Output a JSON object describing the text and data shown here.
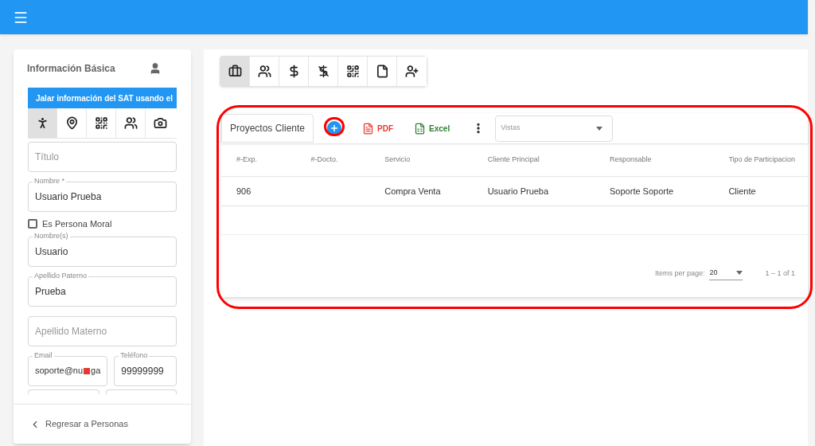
{
  "sidebar": {
    "title": "Información Básica",
    "sat_button": "Jalar información del SAT usando el",
    "tabs": [
      {
        "kind": "person",
        "selected": true
      },
      {
        "kind": "pin",
        "selected": false
      },
      {
        "kind": "qr",
        "selected": false
      },
      {
        "kind": "people",
        "selected": false
      },
      {
        "kind": "camera",
        "selected": false
      }
    ],
    "fields": [
      {
        "kind": "input",
        "placeholder": "Título"
      },
      {
        "kind": "input",
        "label": "Nombre *",
        "value": "Usuario Prueba"
      },
      {
        "kind": "checkbox",
        "label": "Es Persona Moral",
        "checked": false
      },
      {
        "kind": "input",
        "label": "Nombre(s)",
        "value": "Usuario"
      },
      {
        "kind": "input",
        "label": "Apellido Paterno",
        "value": "Prueba"
      },
      {
        "kind": "input",
        "placeholder": "Apellido Materno"
      },
      {
        "kind": "pair",
        "items": [
          {
            "label": "Email",
            "value": "soporte@nu",
            "value_end": "ga",
            "redacted": true
          },
          {
            "label": "Teléfono",
            "value": "99999999"
          }
        ]
      }
    ],
    "back": "Regresar a Personas"
  },
  "toolbar": [
    {
      "kind": "briefcase",
      "selected": true
    },
    {
      "kind": "people",
      "selected": false
    },
    {
      "kind": "dollar",
      "selected": false
    },
    {
      "kind": "dollar-off",
      "selected": false
    },
    {
      "kind": "qr",
      "selected": false
    },
    {
      "kind": "file",
      "selected": false
    },
    {
      "kind": "person-add",
      "selected": false
    }
  ],
  "panel": {
    "tab": "Proyectos Cliente",
    "pdf": "PDF",
    "excel": "Excel",
    "views": {
      "placeholder": "Vistas"
    },
    "columns": [
      "#-Exp.",
      "#-Docto.",
      "Servicio",
      "Cliente Principal",
      "Responsable",
      "Tipo de Participacion"
    ],
    "rows": [
      [
        "906",
        "",
        "Compra Venta",
        "Usuario Prueba",
        "Soporte Soporte",
        "Cliente"
      ]
    ],
    "paginator": {
      "label": "Items per page:",
      "size": "20",
      "range": "1 – 1 of 1"
    }
  }
}
